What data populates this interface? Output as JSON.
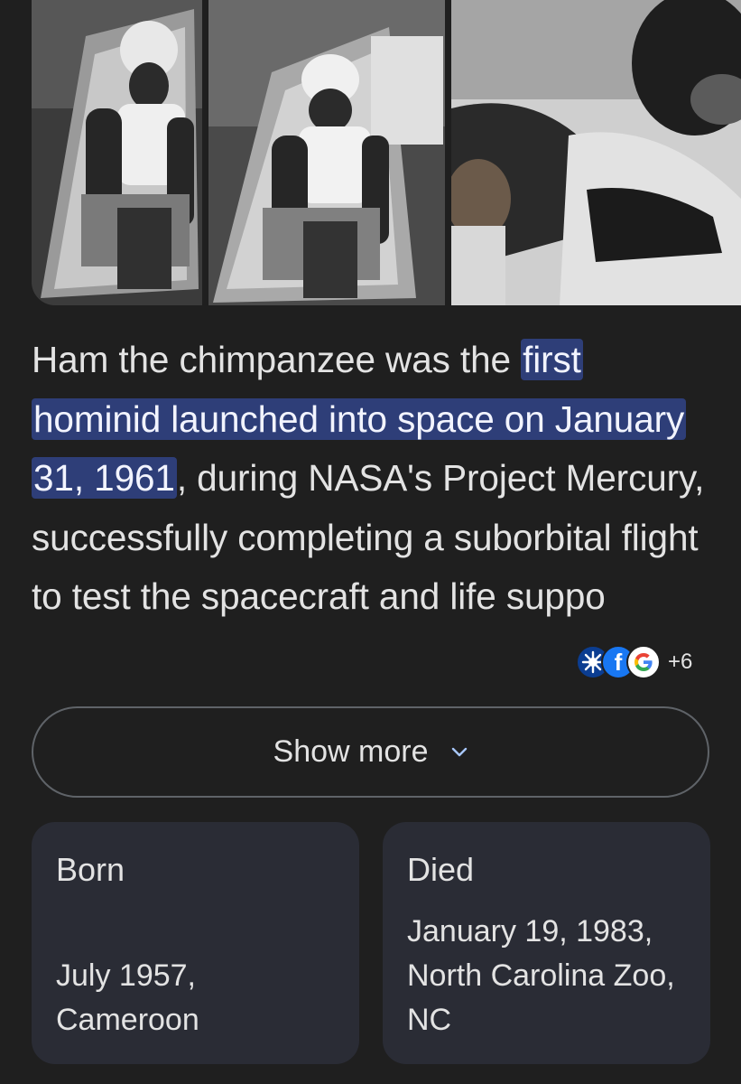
{
  "images": [
    {
      "alt_icon": "chimpanzee-in-capsule-photo"
    },
    {
      "alt_icon": "chimpanzee-in-capsule-photo"
    },
    {
      "alt_icon": "chimpanzee-closeup-photo"
    }
  ],
  "overview": {
    "part1": "Ham the chimpanzee was the ",
    "highlight": "first hominid launched into space on January 31, 1961",
    "part2": ", during NASA's Project Mercury, successfully completing a suborbital flight to test ",
    "faded": "the spacecraft and life suppo"
  },
  "sources": {
    "icons": [
      "nasa-icon",
      "facebook-icon",
      "google-icon"
    ],
    "facebook_letter": "f",
    "more_count": "+6"
  },
  "show_more": {
    "label": "Show more"
  },
  "facts": {
    "born": {
      "title": "Born",
      "value": "July 1957, Cameroon"
    },
    "died": {
      "title": "Died",
      "value": "January 19, 1983, North Carolina Zoo, NC"
    }
  },
  "colors": {
    "background": "#1f1f1f",
    "highlight": "#2e3e78",
    "card": "#2a2c35",
    "border": "#5f6368"
  }
}
